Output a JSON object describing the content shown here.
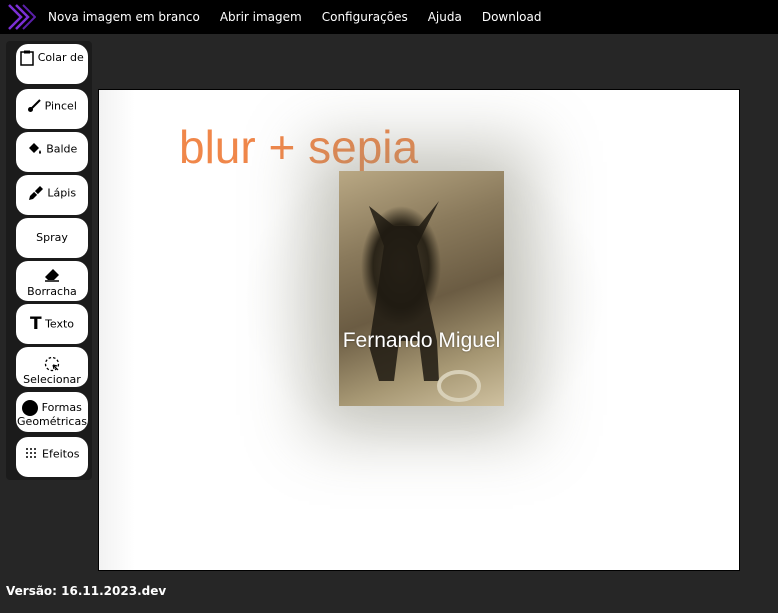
{
  "menu": {
    "items": [
      "Nova imagem em branco",
      "Abrir imagem",
      "Configurações",
      "Ajuda",
      "Download"
    ]
  },
  "toolbar": {
    "tools": [
      {
        "label": "Colar de",
        "icon": "clipboard-icon"
      },
      {
        "label": "Pincel",
        "icon": "brush-icon"
      },
      {
        "label": "Balde",
        "icon": "bucket-icon"
      },
      {
        "label": "Lápis",
        "icon": "pencil-icon"
      },
      {
        "label": "Spray",
        "icon": ""
      },
      {
        "label": "Borracha",
        "icon": "eraser-icon"
      },
      {
        "label": "Texto",
        "icon": "text-icon"
      },
      {
        "label": "Selecionar",
        "icon": "select-icon"
      },
      {
        "label": "Formas Geométricas",
        "icon": "circle-icon"
      },
      {
        "label": "Efeitos",
        "icon": "effects-icon"
      }
    ]
  },
  "canvas": {
    "title_text": "blur + sepia",
    "photo_caption": "Fernando Miguel"
  },
  "footer": {
    "version": "Versão: 16.11.2023.dev"
  },
  "colors": {
    "canvas_text": "#f0874a",
    "topbar": "#000000",
    "background": "#262626"
  }
}
